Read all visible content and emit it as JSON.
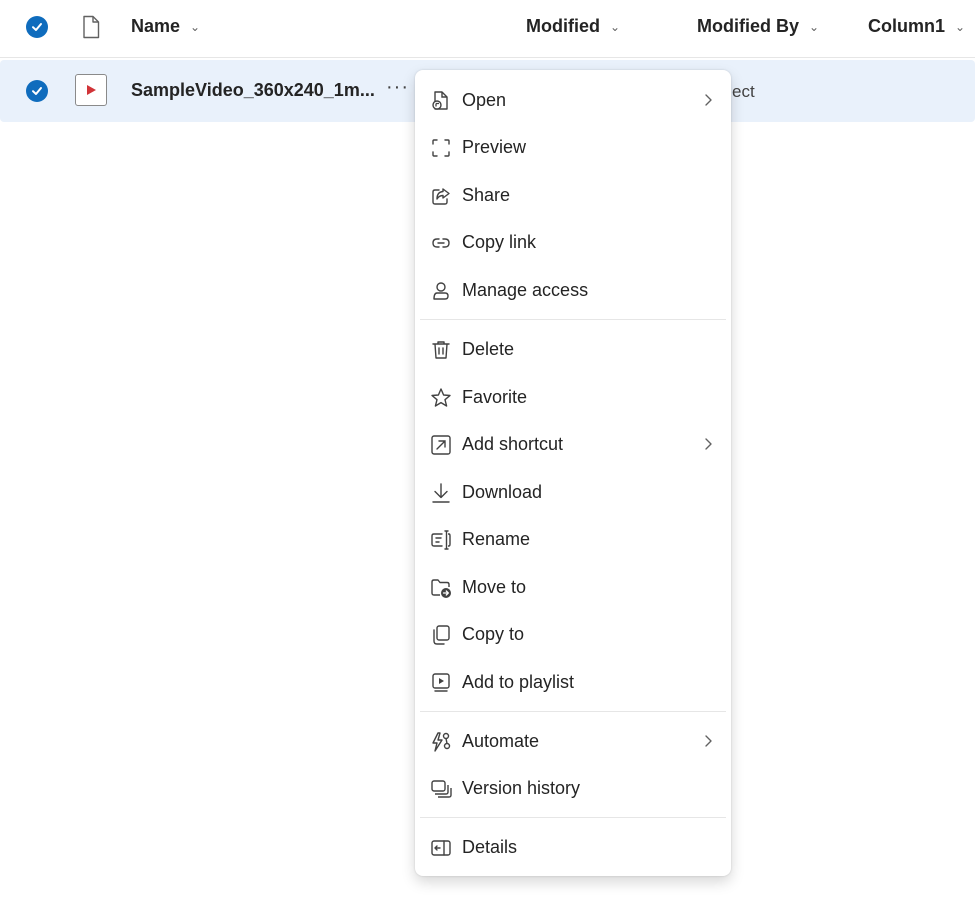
{
  "header": {
    "columns": {
      "name": "Name",
      "modified": "Modified",
      "modified_by": "Modified By",
      "column1": "Column1"
    }
  },
  "row": {
    "file_name": "SampleVideo_360x240_1m...",
    "more_label": "···",
    "modified_by_partial": "ect"
  },
  "context_menu": {
    "items": [
      {
        "label": "Open",
        "icon": "open-icon",
        "submenu": true
      },
      {
        "label": "Preview",
        "icon": "preview-icon"
      },
      {
        "label": "Share",
        "icon": "share-icon"
      },
      {
        "label": "Copy link",
        "icon": "link-icon"
      },
      {
        "label": "Manage access",
        "icon": "person-icon"
      },
      {
        "label": "Delete",
        "icon": "trash-icon"
      },
      {
        "label": "Favorite",
        "icon": "star-icon"
      },
      {
        "label": "Add shortcut",
        "icon": "shortcut-icon",
        "submenu": true
      },
      {
        "label": "Download",
        "icon": "download-icon"
      },
      {
        "label": "Rename",
        "icon": "rename-icon"
      },
      {
        "label": "Move to",
        "icon": "move-folder-icon"
      },
      {
        "label": "Copy to",
        "icon": "copy-icon"
      },
      {
        "label": "Add to playlist",
        "icon": "playlist-icon"
      },
      {
        "label": "Automate",
        "icon": "automate-icon",
        "submenu": true
      },
      {
        "label": "Version history",
        "icon": "version-history-icon"
      },
      {
        "label": "Details",
        "icon": "details-icon"
      }
    ]
  },
  "colors": {
    "accent": "#0f6cbd",
    "selected_row": "#e9f1fb",
    "video_play": "#d13438"
  }
}
